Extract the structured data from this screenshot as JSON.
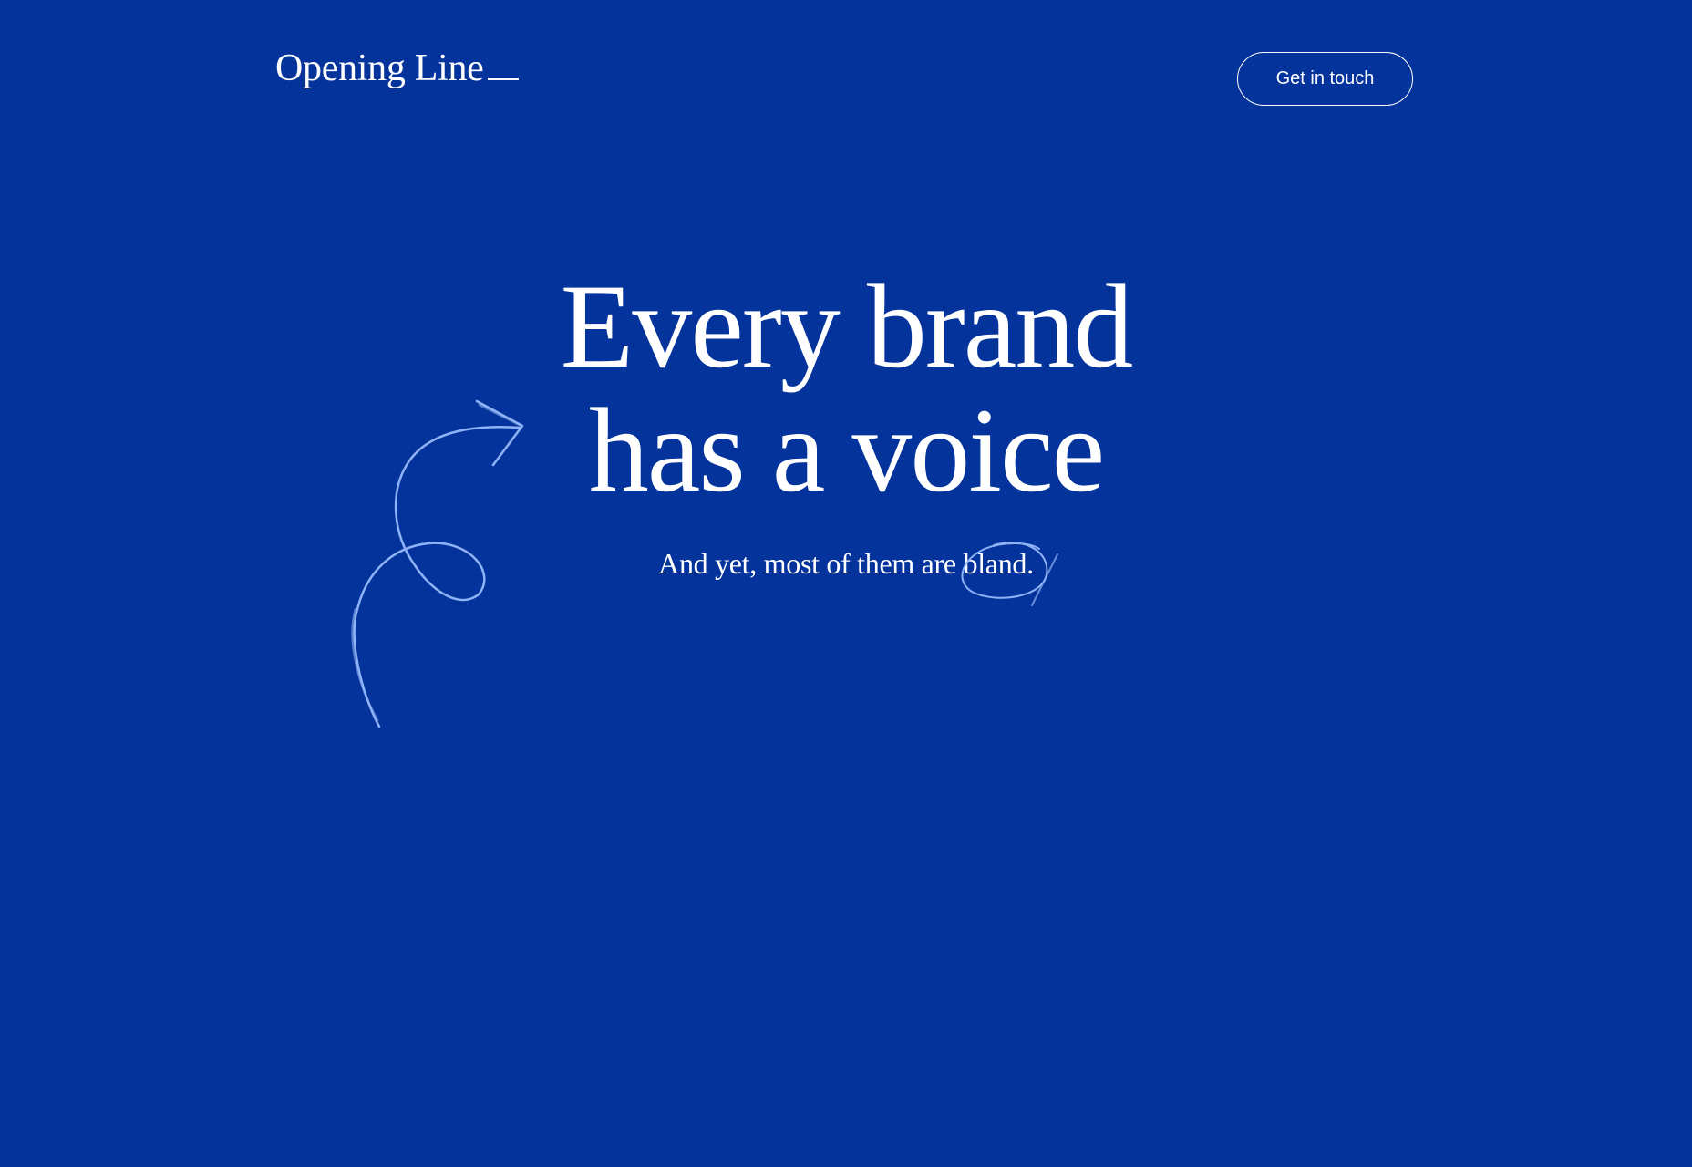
{
  "header": {
    "logo_text": "Opening Line",
    "cta_label": "Get in touch"
  },
  "hero": {
    "headline_line1": "Every brand",
    "headline_line2": "has a voice",
    "subheadline": "And yet, most of them are bland."
  },
  "decorations": {
    "arrow": "hand-drawn-curly-arrow-icon",
    "circle": "hand-drawn-circle-scribble"
  },
  "colors": {
    "background": "#04339c",
    "text": "#ffffff",
    "doodle": "#8fb3f5"
  }
}
